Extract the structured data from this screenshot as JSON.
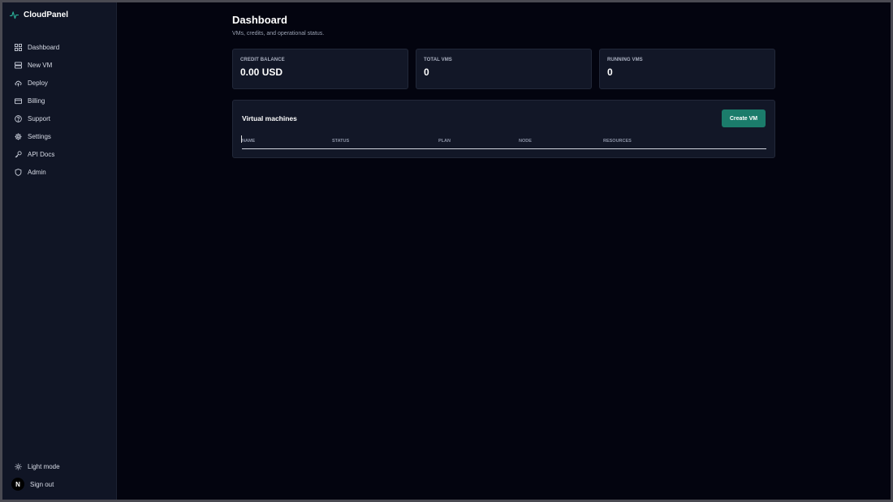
{
  "app": {
    "brand": "CloudPanel",
    "accent_color": "#1b7c6b",
    "brand_icon": "activity-pulse-icon"
  },
  "sidebar": {
    "items": [
      {
        "label": "Dashboard",
        "icon": "grid-icon"
      },
      {
        "label": "New VM",
        "icon": "server-icon"
      },
      {
        "label": "Deploy",
        "icon": "cloud-upload-icon"
      },
      {
        "label": "Billing",
        "icon": "credit-card-icon"
      },
      {
        "label": "Support",
        "icon": "help-circle-icon"
      },
      {
        "label": "Settings",
        "icon": "gear-icon"
      },
      {
        "label": "API Docs",
        "icon": "key-icon"
      },
      {
        "label": "Admin",
        "icon": "shield-icon"
      }
    ],
    "bottom": {
      "theme_toggle": "Light mode",
      "sign_out": "Sign out",
      "avatar_initial": "N"
    }
  },
  "header": {
    "title": "Dashboard",
    "subtitle": "VMs, credits, and operational status."
  },
  "stats": [
    {
      "label": "CREDIT BALANCE",
      "value": "0.00 USD"
    },
    {
      "label": "TOTAL VMS",
      "value": "0"
    },
    {
      "label": "RUNNING VMS",
      "value": "0"
    }
  ],
  "vm_panel": {
    "title": "Virtual machines",
    "create_button": "Create VM",
    "columns": [
      "NAME",
      "STATUS",
      "PLAN",
      "NODE",
      "RESOURCES"
    ],
    "rows": []
  }
}
